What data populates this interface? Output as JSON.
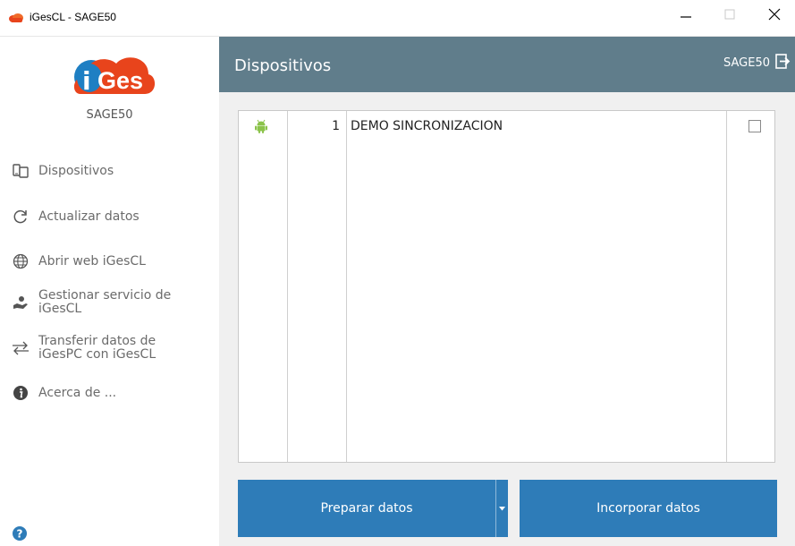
{
  "window": {
    "title": "iGesCL - SAGE50",
    "app_icon": "iges-cloud-logo-icon",
    "controls": {
      "minimize": "minimize-icon",
      "maximize": "maximize-icon",
      "close": "close-icon"
    }
  },
  "sidebar": {
    "logo_text": "iGes",
    "profile_name": "SAGE50",
    "items": [
      {
        "label": "Dispositivos",
        "icon": "devices-icon"
      },
      {
        "label": "Actualizar datos",
        "icon": "refresh-icon"
      },
      {
        "label": "Abrir web iGesCL",
        "icon": "globe-icon"
      },
      {
        "label": "Gestionar servicio de\niGesCL",
        "icon": "service-hand-icon"
      },
      {
        "label": "Transferir datos de\niGesPC con iGesCL",
        "icon": "transfer-arrows-icon"
      },
      {
        "label": "Acerca de ...",
        "icon": "info-icon"
      }
    ],
    "help_icon": "help-icon"
  },
  "header": {
    "title": "Dispositivos",
    "user": "SAGE50",
    "logout_icon": "logout-icon"
  },
  "devices": {
    "rows": [
      {
        "icon": "android-icon",
        "number": "1",
        "name": "DEMO SINCRONIZACION",
        "checked": false
      }
    ]
  },
  "actions": {
    "prepare_label": "Preparar datos",
    "incorporate_label": "Incorporar datos"
  },
  "colors": {
    "header_bg": "#607d8b",
    "button_bg": "#2e7cb8",
    "logo_red": "#e8441c",
    "logo_blue": "#1e7fc3",
    "android_green": "#8bc34a"
  }
}
